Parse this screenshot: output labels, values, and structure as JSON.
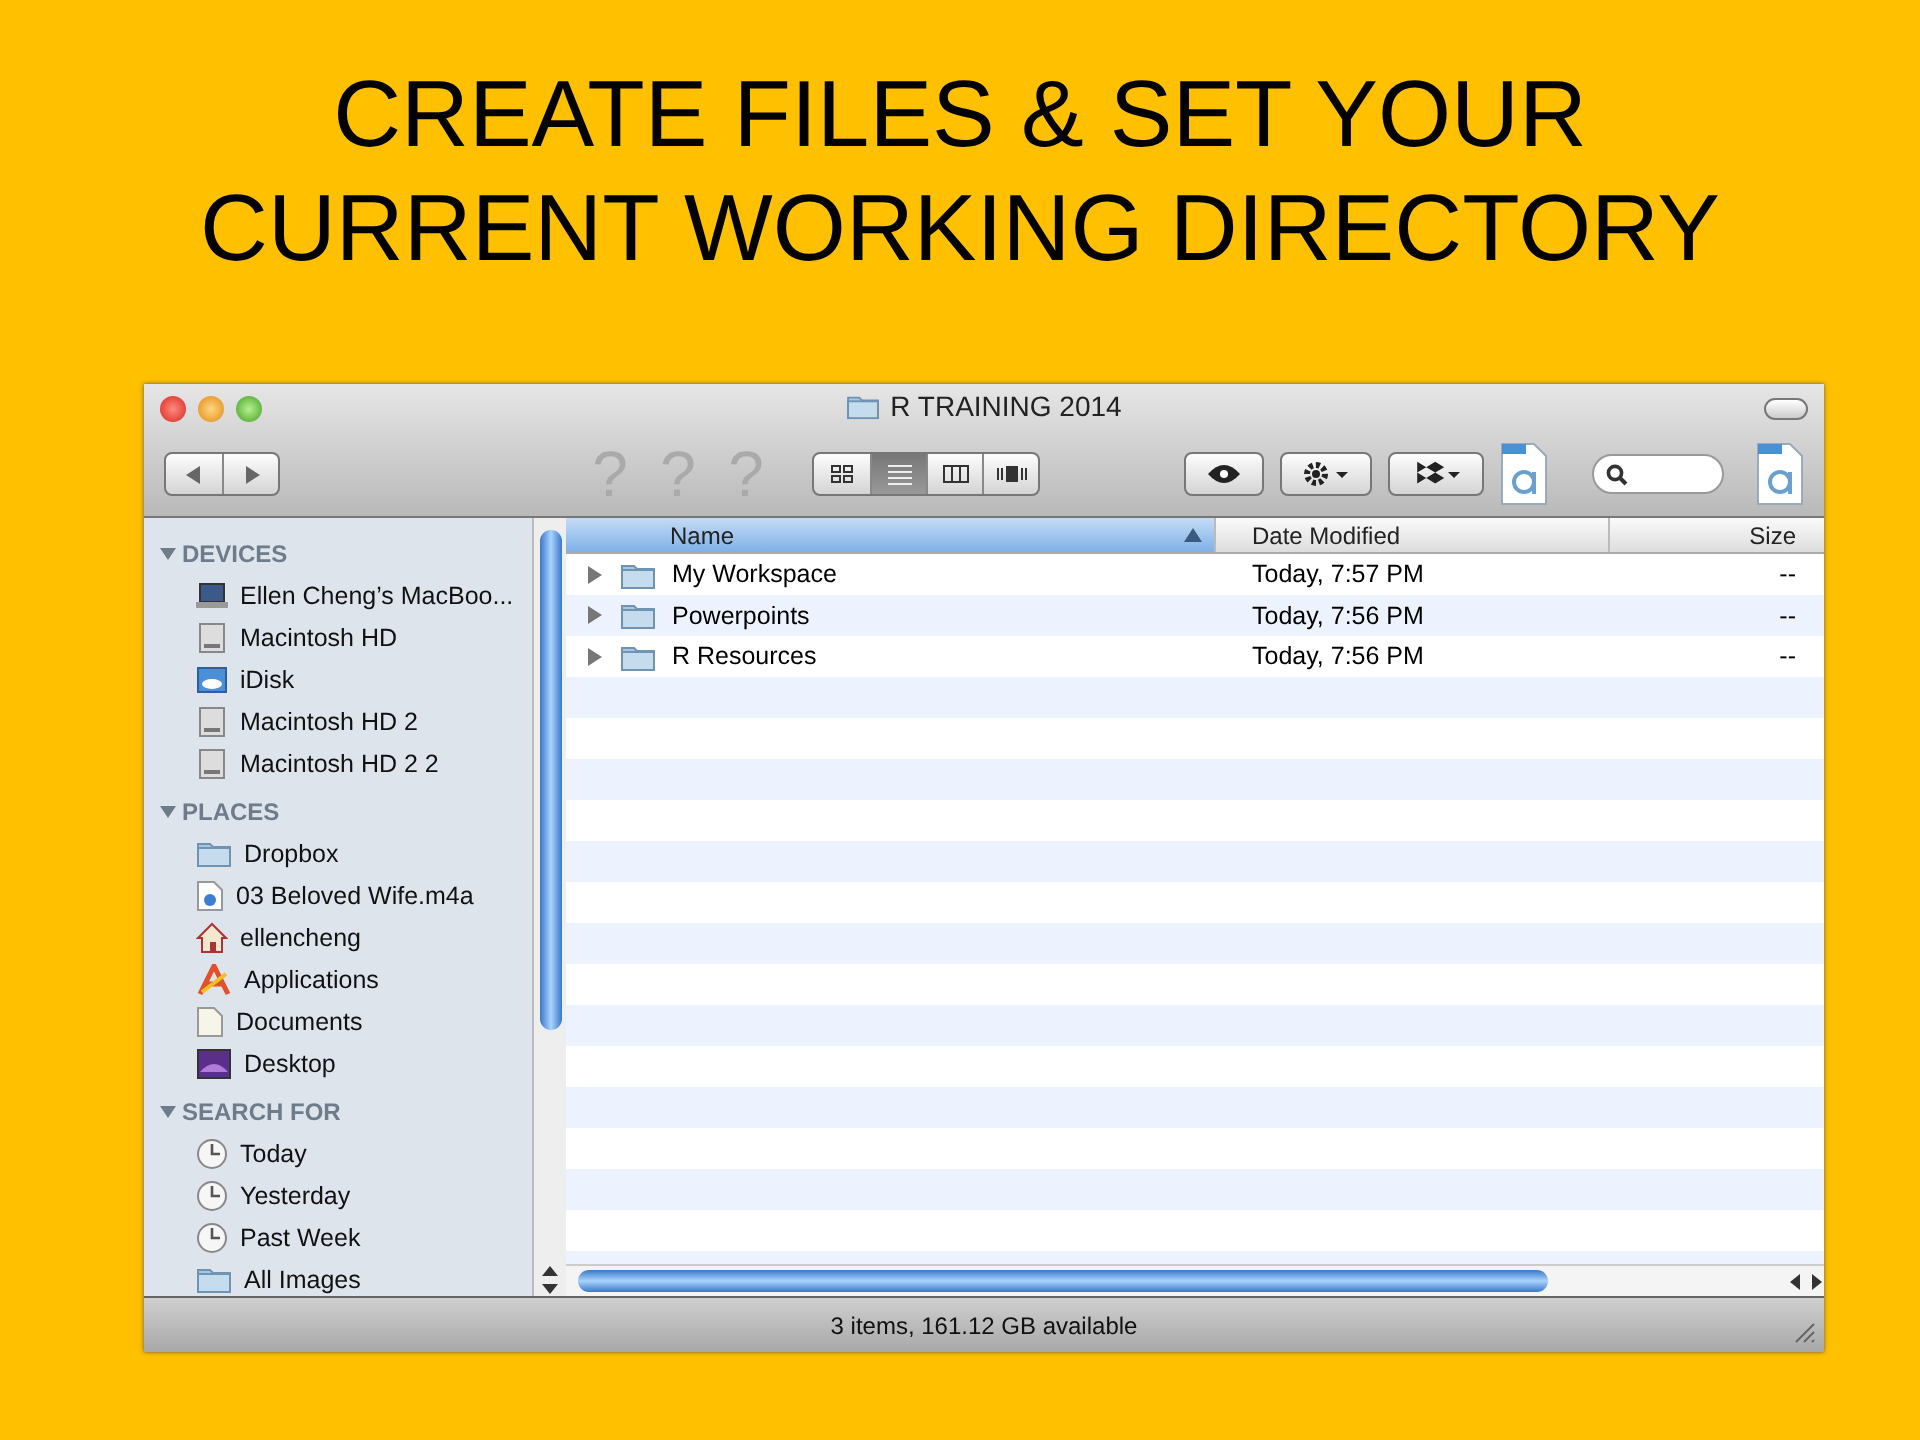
{
  "slide": {
    "title_lines": [
      "CREATE FILES & SET YOUR",
      "CURRENT WORKING DIRECTORY"
    ]
  },
  "window": {
    "title": "R TRAINING 2014"
  },
  "toolbar": {
    "missing_items": [
      "?",
      "?",
      "?"
    ],
    "views": [
      {
        "kind": "icons",
        "selected": false
      },
      {
        "kind": "list",
        "selected": true
      },
      {
        "kind": "columns",
        "selected": false
      },
      {
        "kind": "coverflow",
        "selected": false
      }
    ]
  },
  "sidebar": {
    "sections": [
      {
        "title": "DEVICES",
        "expanded": true,
        "items": [
          {
            "label": "Ellen Cheng’s MacBoo...",
            "kind": "laptop"
          },
          {
            "label": "Macintosh HD",
            "kind": "drive"
          },
          {
            "label": "iDisk",
            "kind": "idisk"
          },
          {
            "label": "Macintosh HD 2",
            "kind": "drive"
          },
          {
            "label": "Macintosh HD 2 2",
            "kind": "drive"
          }
        ]
      },
      {
        "title": "PLACES",
        "expanded": true,
        "items": [
          {
            "label": "Dropbox",
            "kind": "folder"
          },
          {
            "label": "03 Beloved Wife.m4a",
            "kind": "audio"
          },
          {
            "label": "ellencheng",
            "kind": "home"
          },
          {
            "label": "Applications",
            "kind": "apps"
          },
          {
            "label": "Documents",
            "kind": "document"
          },
          {
            "label": "Desktop",
            "kind": "desktop"
          }
        ]
      },
      {
        "title": "SEARCH FOR",
        "expanded": true,
        "items": [
          {
            "label": "Today",
            "kind": "clock"
          },
          {
            "label": "Yesterday",
            "kind": "clock"
          },
          {
            "label": "Past Week",
            "kind": "clock"
          },
          {
            "label": "All Images",
            "kind": "folder"
          }
        ]
      }
    ]
  },
  "table": {
    "columns": [
      {
        "label": "Name",
        "selected": true
      },
      {
        "label": "Date Modified",
        "selected": false
      },
      {
        "label": "Size",
        "selected": false
      }
    ],
    "rows": [
      {
        "name": "My Workspace",
        "date": "Today, 7:57 PM",
        "size": "--",
        "expanded": false
      },
      {
        "name": "Powerpoints",
        "date": "Today, 7:56 PM",
        "size": "--",
        "expanded": false
      },
      {
        "name": "R Resources",
        "date": "Today, 7:56 PM",
        "size": "--",
        "expanded": false
      }
    ]
  },
  "status_bar": {
    "text": "3 items, 161.12 GB available"
  }
}
